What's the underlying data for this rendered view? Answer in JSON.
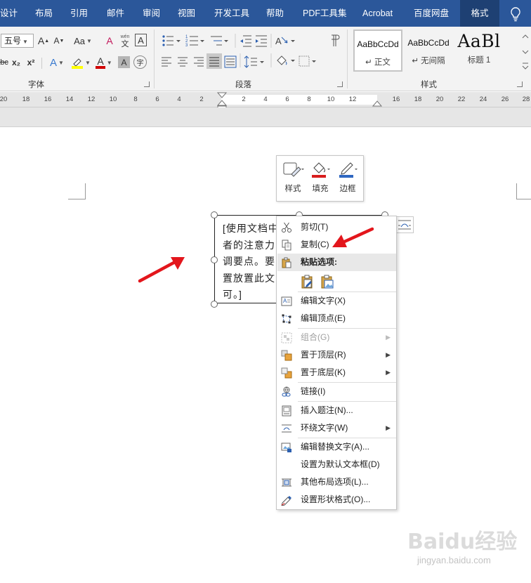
{
  "tabs": [
    "设计",
    "布局",
    "引用",
    "邮件",
    "审阅",
    "视图",
    "开发工具",
    "帮助",
    "PDF工具集",
    "Acrobat",
    "百度网盘",
    "格式"
  ],
  "active_tab": "格式",
  "ribbon": {
    "font": {
      "label": "字体",
      "size_value": "五号",
      "grow_font": "A",
      "shrink_font": "A",
      "change_case": "Aa",
      "clear_format": "A",
      "phonetic_top": "wén",
      "phonetic_bottom": "文",
      "char_border": "A",
      "strike": "abc",
      "subscript": "x₂",
      "superscript": "x²",
      "text_effects": "A",
      "font_color": "A",
      "char_shading": "A",
      "enclose": "字"
    },
    "paragraph": {
      "label": "段落"
    },
    "styles": {
      "label": "样式",
      "items": [
        {
          "sample": "AaBbCcDd",
          "name": "↵ 正文"
        },
        {
          "sample": "AaBbCcDd",
          "name": "↵ 无间隔"
        },
        {
          "sample": "AaBl",
          "name": "标题 1"
        }
      ]
    }
  },
  "ruler": {
    "ticks": [
      "20",
      "18",
      "16",
      "14",
      "12",
      "10",
      "8",
      "6",
      "4",
      "2",
      "2",
      "4",
      "6",
      "8",
      "10",
      "12",
      "16",
      "18",
      "20",
      "22",
      "24",
      "26",
      "28"
    ]
  },
  "mini_toolbar": {
    "style_label": "样式",
    "fill_label": "填充",
    "border_label": "边框"
  },
  "textbox": {
    "lines": [
      "[使用文档中",
      "者的注意力",
      "调要点。要",
      "置放置此文",
      "可。]"
    ]
  },
  "context_menu": {
    "items": [
      {
        "label": "剪切(T)",
        "icon": "scissors-icon"
      },
      {
        "label": "复制(C)",
        "icon": "copy-icon"
      },
      {
        "label": "粘贴选项:",
        "icon": "paste-icon"
      },
      {
        "label": "编辑文字(X)",
        "icon": "edit-text-icon"
      },
      {
        "label": "编辑顶点(E)",
        "icon": "edit-points-icon"
      },
      {
        "label": "组合(G)",
        "icon": "group-icon"
      },
      {
        "label": "置于顶层(R)",
        "icon": "bring-front-icon"
      },
      {
        "label": "置于底层(K)",
        "icon": "send-back-icon"
      },
      {
        "label": "链接(I)",
        "icon": "link-icon"
      },
      {
        "label": "插入题注(N)...",
        "icon": "caption-icon"
      },
      {
        "label": "环绕文字(W)",
        "icon": "wrap-text-icon"
      },
      {
        "label": "编辑替换文字(A)...",
        "icon": "alt-text-icon"
      },
      {
        "label": "设置为默认文本框(D)",
        "icon": ""
      },
      {
        "label": "其他布局选项(L)...",
        "icon": "layout-options-icon"
      },
      {
        "label": "设置形状格式(O)...",
        "icon": "format-shape-icon"
      }
    ]
  },
  "watermark": {
    "main": "Baidu经验",
    "sub": "jingyan.baidu.com"
  },
  "colors": {
    "tab_bar": "#2b579a",
    "active_tab": "#1e4073",
    "highlight_yellow": "#ffff00",
    "font_red": "#d00000",
    "annotation_red": "#e3161c"
  }
}
